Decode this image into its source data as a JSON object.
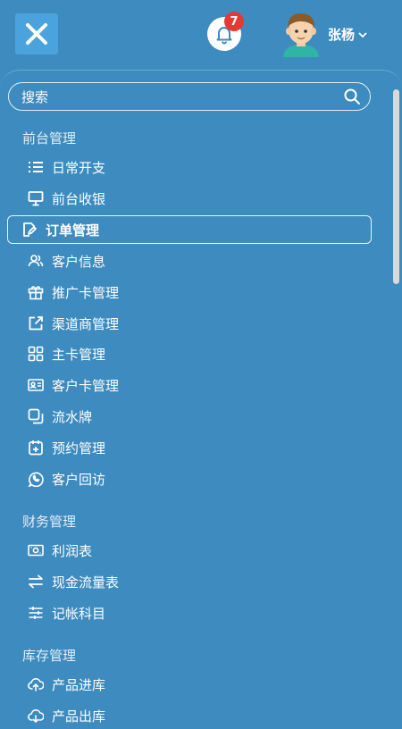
{
  "header": {
    "notification_count": "7",
    "username": "张杨",
    "colors": {
      "close_button_bg": "#4aa3dd",
      "badge": "#e53935",
      "page_bg": "#3d8bbf"
    }
  },
  "search": {
    "label": "搜索"
  },
  "sections": [
    {
      "title": "前台管理",
      "items": [
        {
          "label": "日常开支",
          "icon": "list-icon"
        },
        {
          "label": "前台收银",
          "icon": "monitor-icon"
        },
        {
          "label": "订单管理",
          "icon": "edit-document-icon",
          "active": true
        },
        {
          "label": "客户信息",
          "icon": "users-icon"
        },
        {
          "label": "推广卡管理",
          "icon": "gift-icon"
        },
        {
          "label": "渠道商管理",
          "icon": "external-link-icon"
        },
        {
          "label": "主卡管理",
          "icon": "grid-icon"
        },
        {
          "label": "客户卡管理",
          "icon": "id-card-icon"
        },
        {
          "label": "流水牌",
          "icon": "copy-icon"
        },
        {
          "label": "预约管理",
          "icon": "calendar-add-icon"
        },
        {
          "label": "客户回访",
          "icon": "whatsapp-icon"
        }
      ]
    },
    {
      "title": "财务管理",
      "items": [
        {
          "label": "利润表",
          "icon": "money-icon"
        },
        {
          "label": "现金流量表",
          "icon": "swap-arrows-icon"
        },
        {
          "label": "记帐科目",
          "icon": "sliders-icon"
        }
      ]
    },
    {
      "title": "库存管理",
      "items": [
        {
          "label": "产品进库",
          "icon": "cloud-upload-icon"
        },
        {
          "label": "产品出库",
          "icon": "cloud-download-icon"
        }
      ]
    }
  ]
}
